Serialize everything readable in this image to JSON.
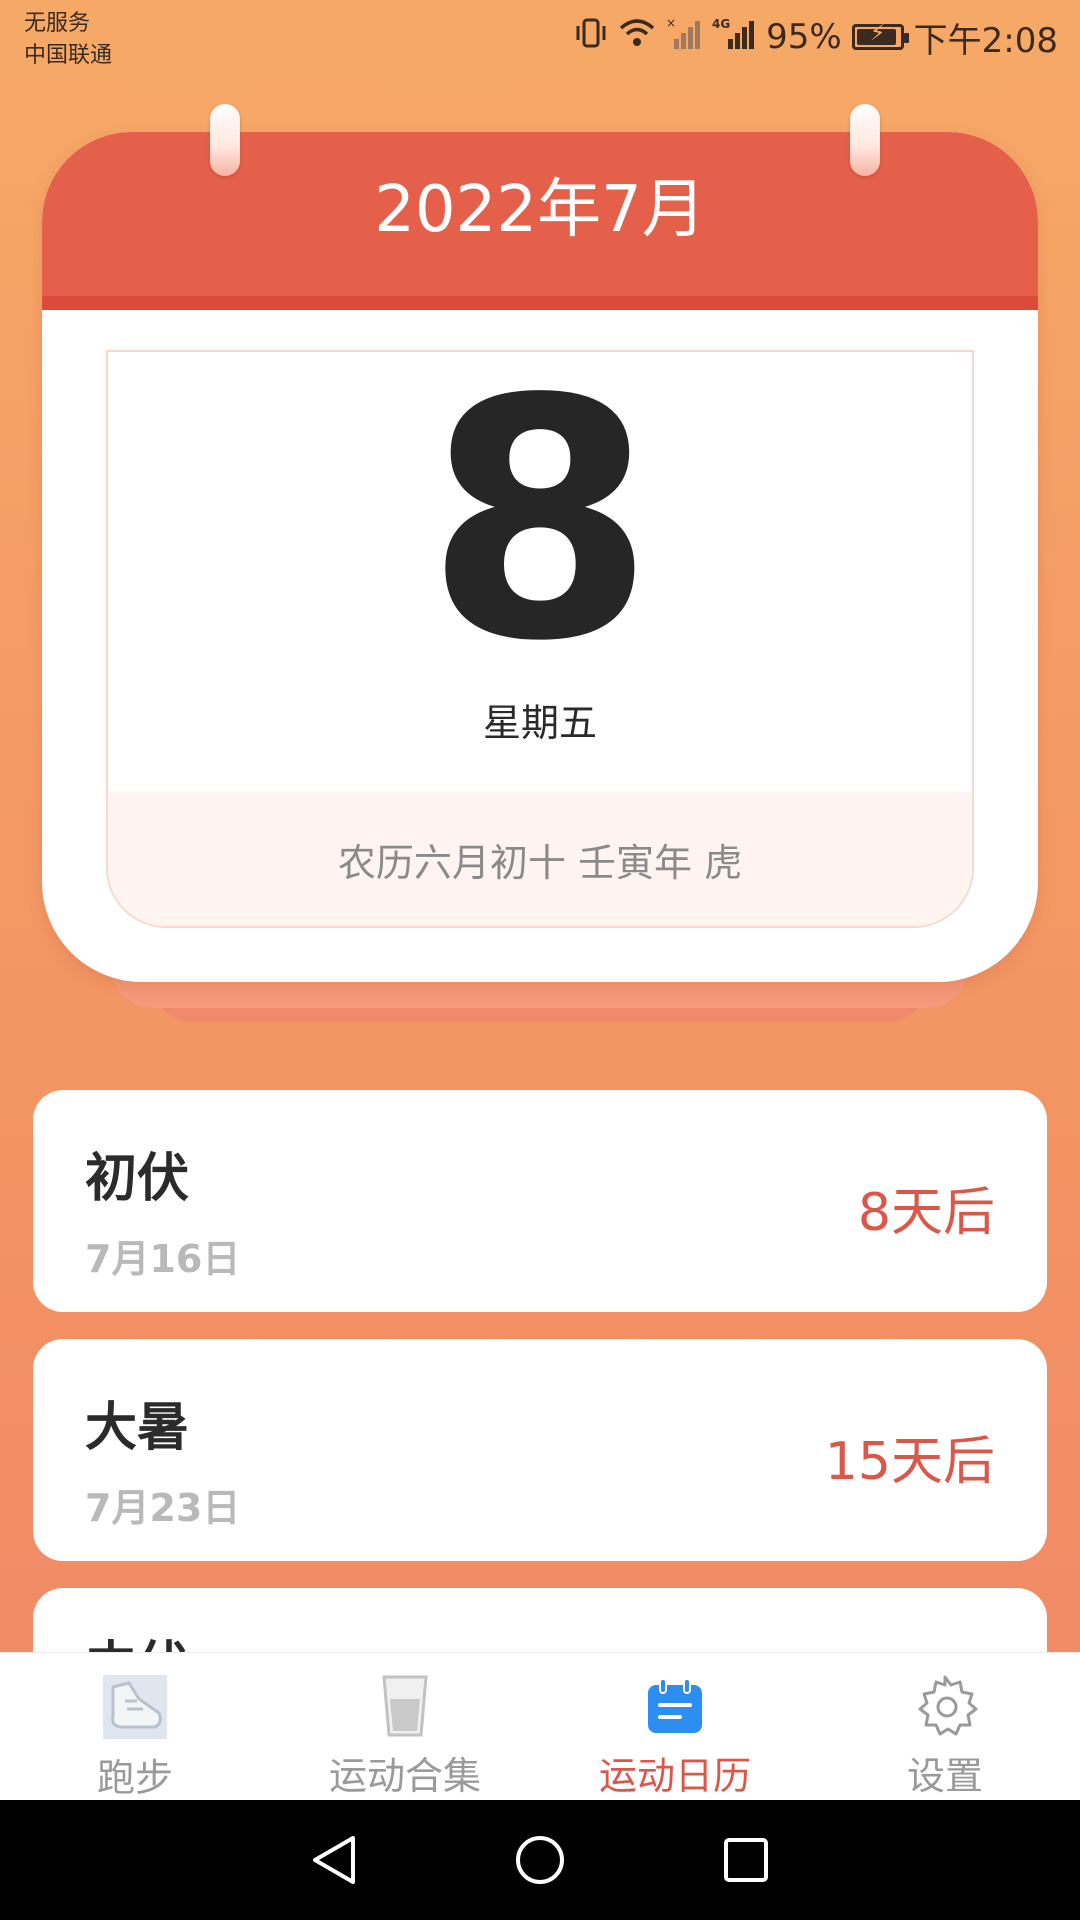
{
  "status_bar": {
    "carrier_line1": "无服务",
    "carrier_line2": "中国联通",
    "network": "4G",
    "battery": "95%",
    "battery_level": 0.95,
    "time": "下午2:08"
  },
  "calendar": {
    "month_title": "2022年7月",
    "day": "8",
    "weekday": "星期五",
    "lunar": "农历六月初十 壬寅年 虎"
  },
  "events": [
    {
      "name": "初伏",
      "date": "7月16日",
      "countdown": "8天后"
    },
    {
      "name": "大暑",
      "date": "7月23日",
      "countdown": "15天后"
    },
    {
      "name": "中伏"
    }
  ],
  "bottom_nav": {
    "items": [
      {
        "label": "跑步",
        "icon": "shoe-icon"
      },
      {
        "label": "运动合集",
        "icon": "cup-icon"
      },
      {
        "label": "运动日历",
        "icon": "calendar-icon",
        "active": true
      },
      {
        "label": "设置",
        "icon": "gear-icon"
      }
    ]
  },
  "colors": {
    "accent": "#d9584a",
    "calendar_header": "#e5604a",
    "background_top": "#f6a967",
    "background_bottom": "#f1876a"
  }
}
